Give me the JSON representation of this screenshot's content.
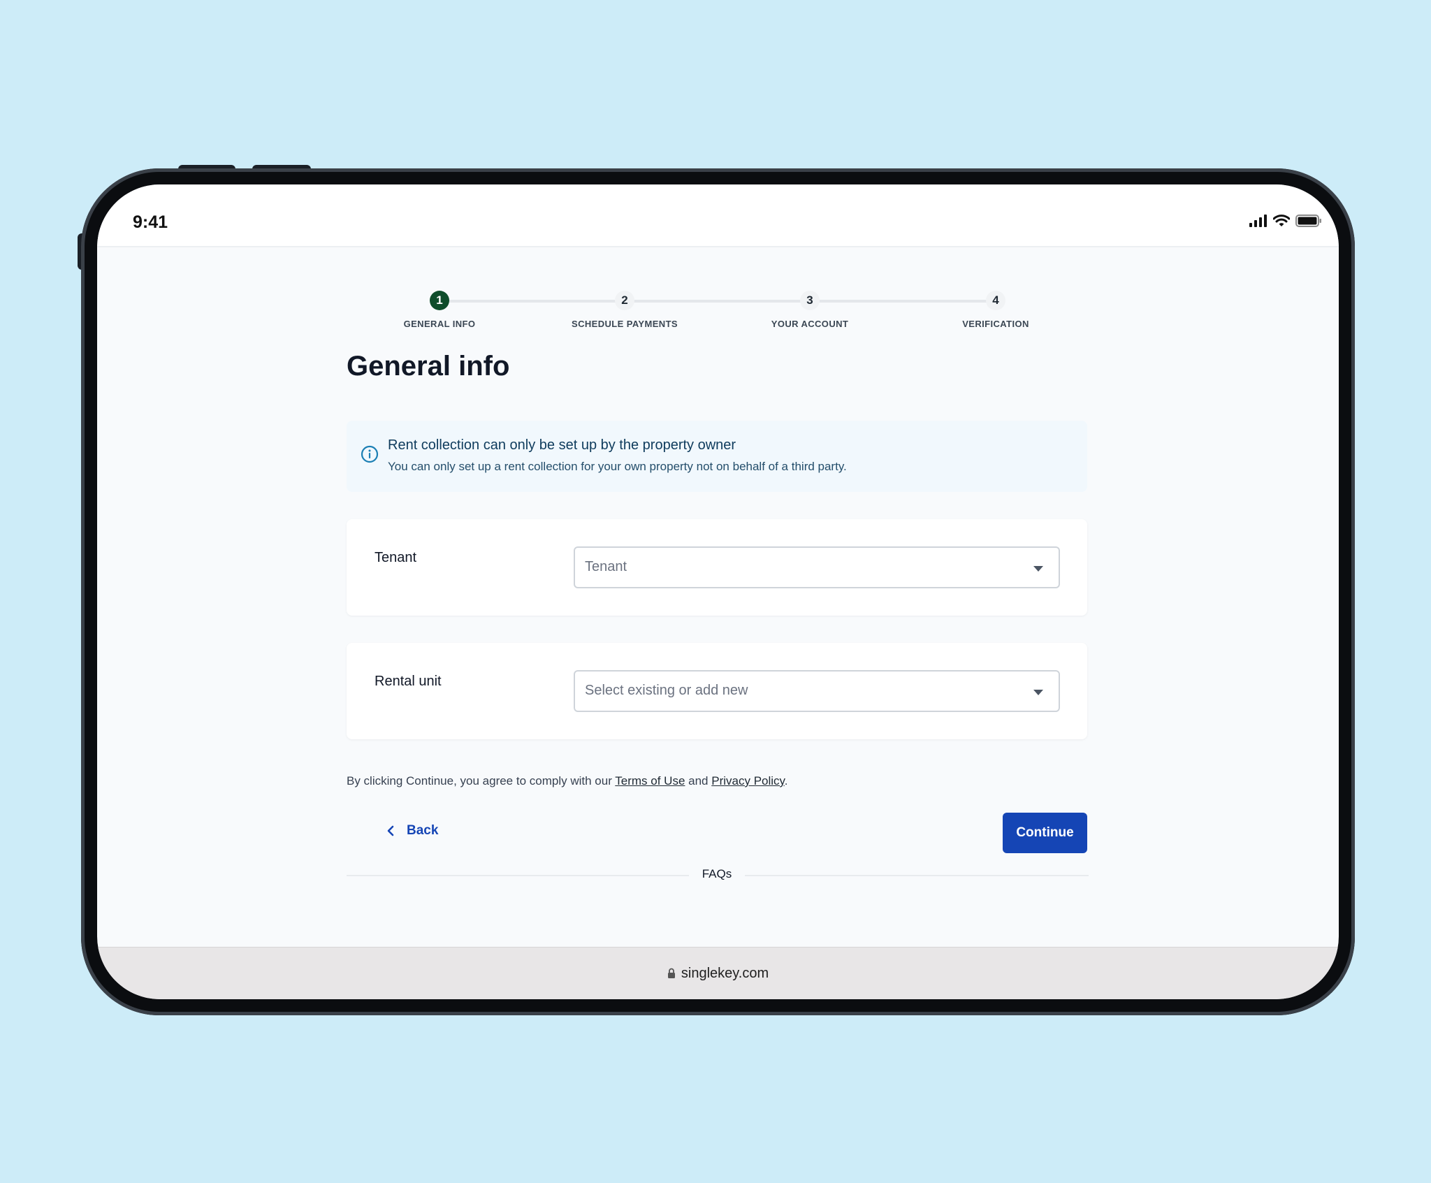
{
  "status_bar": {
    "time": "9:41"
  },
  "stepper": {
    "steps": [
      {
        "number": "1",
        "label": "GENERAL INFO"
      },
      {
        "number": "2",
        "label": "SCHEDULE PAYMENTS"
      },
      {
        "number": "3",
        "label": "YOUR ACCOUNT"
      },
      {
        "number": "4",
        "label": "VERIFICATION"
      }
    ],
    "active_step": 1
  },
  "page": {
    "title": "General info"
  },
  "info_box": {
    "icon": "info-icon",
    "title": "Rent collection can only be set up by the property owner",
    "subtitle": "You can only set up a rent collection for your own property not on behalf of a third party."
  },
  "fields": {
    "tenant": {
      "label": "Tenant",
      "placeholder": "Tenant"
    },
    "rental_unit": {
      "label": "Rental unit",
      "placeholder": "Select existing or add new"
    }
  },
  "terms": {
    "prefix": "By clicking Continue, you agree to comply with our ",
    "terms_link": "Terms of Use",
    "middle": " and ",
    "privacy_link": "Privacy Policy",
    "suffix": "."
  },
  "actions": {
    "back_label": "Back",
    "continue_label": "Continue"
  },
  "faqs": {
    "label": "FAQs"
  },
  "browser": {
    "url": "singlekey.com"
  },
  "colors": {
    "primary": "#1545b5",
    "active_step": "#0f4d2b",
    "info_background": "#f1f8fd",
    "page_background": "#cdecf8"
  }
}
